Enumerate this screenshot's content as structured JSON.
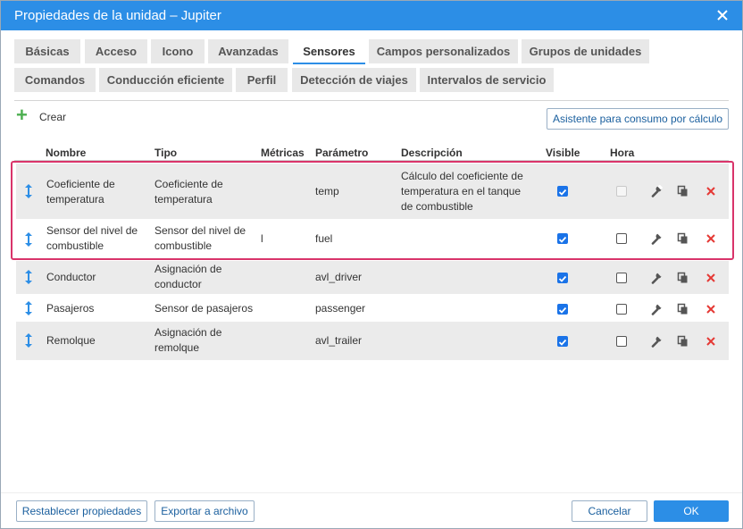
{
  "window": {
    "title": "Propiedades de la unidad – Jupiter",
    "close_icon": "close-icon"
  },
  "tabs": [
    {
      "label": "Básicas"
    },
    {
      "label": "Acceso"
    },
    {
      "label": "Icono"
    },
    {
      "label": "Avanzadas"
    },
    {
      "label": "Sensores",
      "active": true
    },
    {
      "label": "Campos personalizados"
    },
    {
      "label": "Grupos de unidades"
    },
    {
      "label": "Comandos"
    },
    {
      "label": "Conducción eficiente"
    },
    {
      "label": "Perfil"
    },
    {
      "label": "Detección de viajes"
    },
    {
      "label": "Intervalos de servicio"
    }
  ],
  "toolbar": {
    "create_label": "Crear",
    "wizard_label": "Asistente para consumo por cálculo"
  },
  "table": {
    "headers": {
      "name": "Nombre",
      "type": "Tipo",
      "metrics": "Métricas",
      "param": "Parámetro",
      "desc": "Descripción",
      "visible": "Visible",
      "hora": "Hora"
    },
    "rows": [
      {
        "name": "Coeficiente de temperatura",
        "type": "Coeficiente de temperatura",
        "metrics": "",
        "param": "temp",
        "desc": "Cálculo del coeficiente de temperatura en el tanque de combustible",
        "visible": true,
        "hora": "disabled"
      },
      {
        "name": "Sensor del nivel de combustible",
        "type": "Sensor del nivel de combustible",
        "metrics": "l",
        "param": "fuel",
        "desc": "",
        "visible": true,
        "hora": false
      },
      {
        "name": "Conductor",
        "type": "Asignación de conductor",
        "metrics": "",
        "param": "avl_driver",
        "desc": "",
        "visible": true,
        "hora": false
      },
      {
        "name": "Pasajeros",
        "type": "Sensor de pasajeros",
        "metrics": "",
        "param": "passenger",
        "desc": "",
        "visible": true,
        "hora": false
      },
      {
        "name": "Remolque",
        "type": "Asignación de remolque",
        "metrics": "",
        "param": "avl_trailer",
        "desc": "",
        "visible": true,
        "hora": false
      }
    ]
  },
  "footer": {
    "reset_label": "Restablecer propiedades",
    "export_label": "Exportar a archivo",
    "cancel_label": "Cancelar",
    "ok_label": "OK"
  },
  "colors": {
    "accent": "#2c8ee6",
    "highlight": "#d9346a",
    "delete": "#e53935",
    "create": "#4caf50"
  }
}
